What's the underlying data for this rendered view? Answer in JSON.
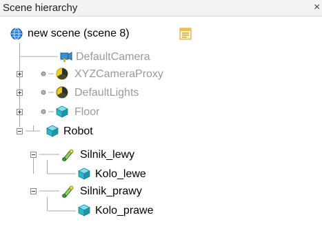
{
  "panel": {
    "title": "Scene hierarchy",
    "close_glyph": "×"
  },
  "tree": {
    "root": {
      "label": "new scene (scene 8)",
      "icon": "globe-icon",
      "extra_icon": "scene-properties-icon"
    },
    "items": [
      {
        "label": "DefaultCamera",
        "icon": "camera-icon",
        "style": "gray",
        "expander": "none"
      },
      {
        "label": "XYZCameraProxy",
        "icon": "dummy-icon",
        "style": "gray",
        "expander": "plus"
      },
      {
        "label": "DefaultLights",
        "icon": "light-icon",
        "style": "gray",
        "expander": "plus"
      },
      {
        "label": "Floor",
        "icon": "cube-icon",
        "style": "gray",
        "expander": "plus"
      },
      {
        "label": "Robot",
        "icon": "cube-icon",
        "style": "dark",
        "expander": "minus"
      },
      {
        "label": "Silnik_lewy",
        "icon": "joint-icon",
        "style": "dark",
        "expander": "minus"
      },
      {
        "label": "Kolo_lewe",
        "icon": "cube-icon",
        "style": "dark",
        "expander": "none"
      },
      {
        "label": "Silnik_prawy",
        "icon": "joint-icon",
        "style": "dark",
        "expander": "minus"
      },
      {
        "label": "Kolo_prawe",
        "icon": "cube-icon",
        "style": "dark",
        "expander": "none"
      }
    ]
  },
  "colors": {
    "cube": "#2fb5c8",
    "joint": "#3a9a3a",
    "camera": "#3a8fd0",
    "tree_line": "#a0a0a0"
  }
}
